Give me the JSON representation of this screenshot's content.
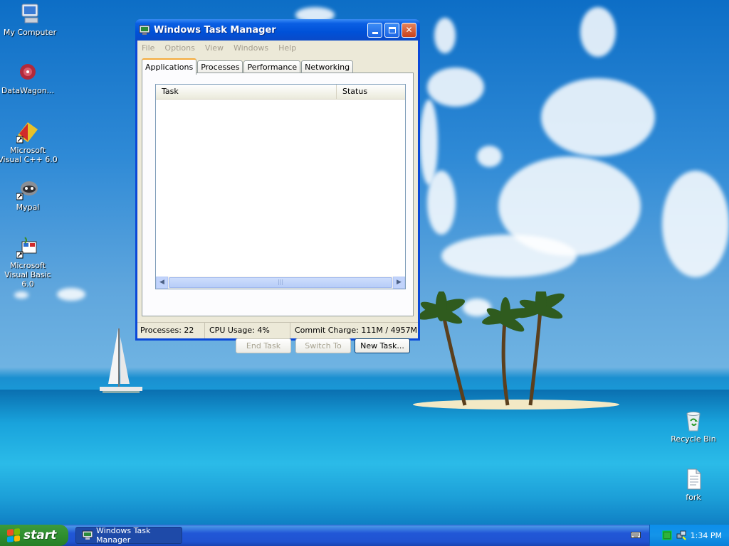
{
  "desktop": {
    "icons": [
      {
        "label": "My Computer",
        "icon": "my-computer-icon"
      },
      {
        "label": "DataWagon...",
        "icon": "datawagon-icon"
      },
      {
        "label": "Microsoft Visual C++ 6.0",
        "icon": "visual-cpp-icon"
      },
      {
        "label": "Mypal",
        "icon": "mypal-icon"
      },
      {
        "label": "Microsoft Visual Basic 6.0",
        "icon": "visual-basic-icon"
      },
      {
        "label": "Recycle Bin",
        "icon": "recycle-bin-icon"
      },
      {
        "label": "fork",
        "icon": "file-icon"
      }
    ]
  },
  "window": {
    "title": "Windows Task Manager",
    "menu": [
      "File",
      "Options",
      "View",
      "Windows",
      "Help"
    ],
    "tabs": [
      "Applications",
      "Processes",
      "Performance",
      "Networking"
    ],
    "active_tab": "Applications",
    "columns": [
      "Task",
      "Status"
    ],
    "buttons": {
      "end_task": "End Task",
      "switch_to": "Switch To",
      "new_task": "New Task..."
    },
    "status": {
      "processes": "Processes: 22",
      "cpu": "CPU Usage: 4%",
      "commit": "Commit Charge: 111M / 4957M"
    }
  },
  "taskbar": {
    "start_label": "start",
    "items": [
      {
        "label": "Windows Task Manager"
      }
    ],
    "clock": "1:34 PM"
  },
  "colors": {
    "titlebar": "#0a5fe3",
    "window_body": "#ece9d8",
    "taskbar": "#2157d7",
    "start_button": "#2f8f2f",
    "tray": "#0c8eea"
  }
}
